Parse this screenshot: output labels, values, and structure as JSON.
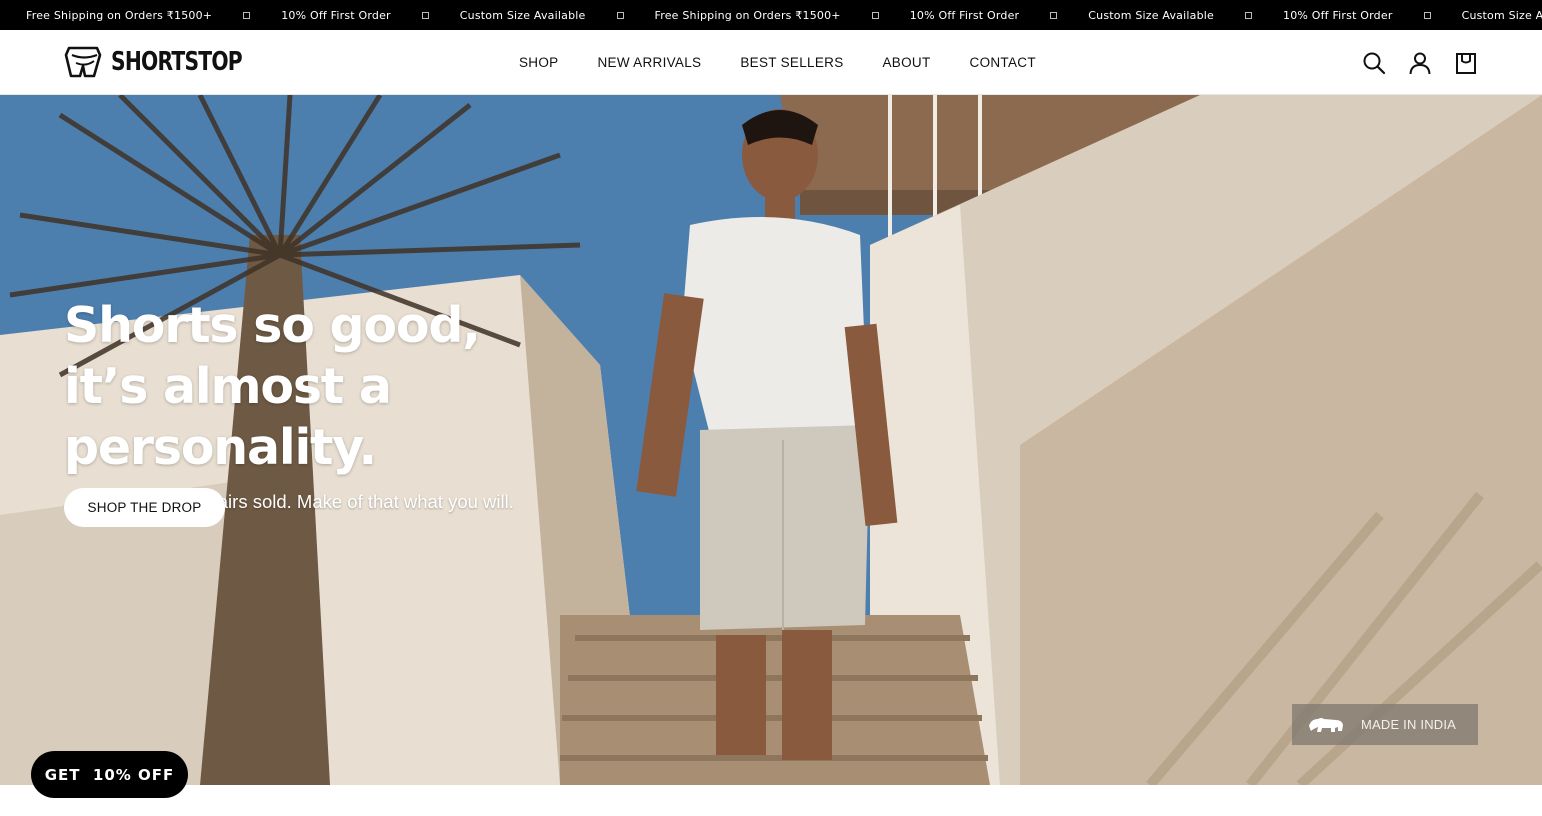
{
  "announcement": {
    "items": [
      "Free Shipping on Orders ₹1500+",
      "10% Off First Order",
      "Custom Size Available",
      "Free Shipping on Orders ₹1500+",
      "10% Off First Order",
      "Custom Size Available",
      "10% Off First Order",
      "Custom Size Available"
    ]
  },
  "header": {
    "logo_text": "SHORTSTOP",
    "nav": [
      "SHOP",
      "NEW ARRIVALS",
      "BEST SELLERS",
      "ABOUT",
      "CONTACT"
    ],
    "icons": [
      "search-icon",
      "account-icon",
      "cart-icon"
    ]
  },
  "hero": {
    "title_line1": "Shorts so good,",
    "title_line2": "it’s almost a personality.",
    "subtitle": "4.8 stars. 4,000+ pairs sold. Make of that what you will.",
    "cta_label": "SHOP THE DROP",
    "badge_text": "MADE IN INDIA",
    "badge_icon": "lion-icon"
  },
  "discount": {
    "label": "GET  10% OFF"
  },
  "colors": {
    "announcement_bg": "#000000",
    "header_bg": "#ffffff",
    "cta_bg": "#ffffff",
    "discount_bg": "#000000",
    "badge_bg": "#827a70"
  }
}
